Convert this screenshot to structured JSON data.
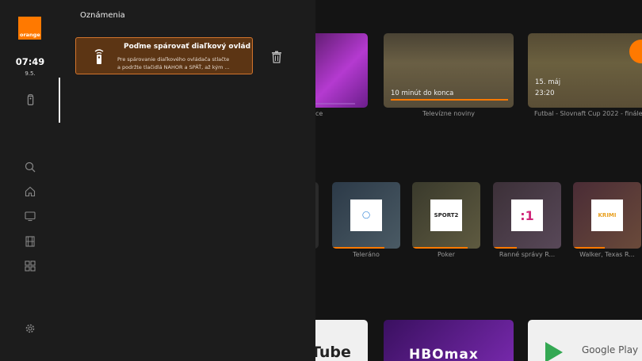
{
  "sidebar": {
    "logo_text": "orange",
    "time": "07:49",
    "date": "9.5."
  },
  "panel": {
    "title": "Oznámenia",
    "notification": {
      "title": "Poďme spárovať diaľkový ovlád",
      "body_line1": "Pre spárovanie diaľkového ovládača stlačte",
      "body_line2": "a podržte tlačidlá NAHOR a SPÄŤ, až kým ..."
    }
  },
  "content": {
    "row1": [
      {
        "caption": "ce"
      },
      {
        "caption": "Televízne noviny",
        "overlay": "10 minút do konca"
      },
      {
        "caption": "Futbal - Slovnaft Cup 2022 - finále",
        "overlay1": "15. máj",
        "overlay2": "23:20"
      }
    ],
    "row2": [
      {
        "caption": "Teleráno"
      },
      {
        "caption": "Poker",
        "logo": "SPORT2"
      },
      {
        "caption": "Ranné správy R...",
        "logo": ":1"
      },
      {
        "caption": "Walker, Texas R...",
        "logo": "KRIMI"
      }
    ],
    "row3": [
      {
        "label": "Tube"
      },
      {
        "label": "HBOmax"
      },
      {
        "label": "Google Play"
      }
    ]
  },
  "colors": {
    "accent": "#ff7900",
    "notification_bg": "#5c3514",
    "notification_border": "#d2742c"
  }
}
